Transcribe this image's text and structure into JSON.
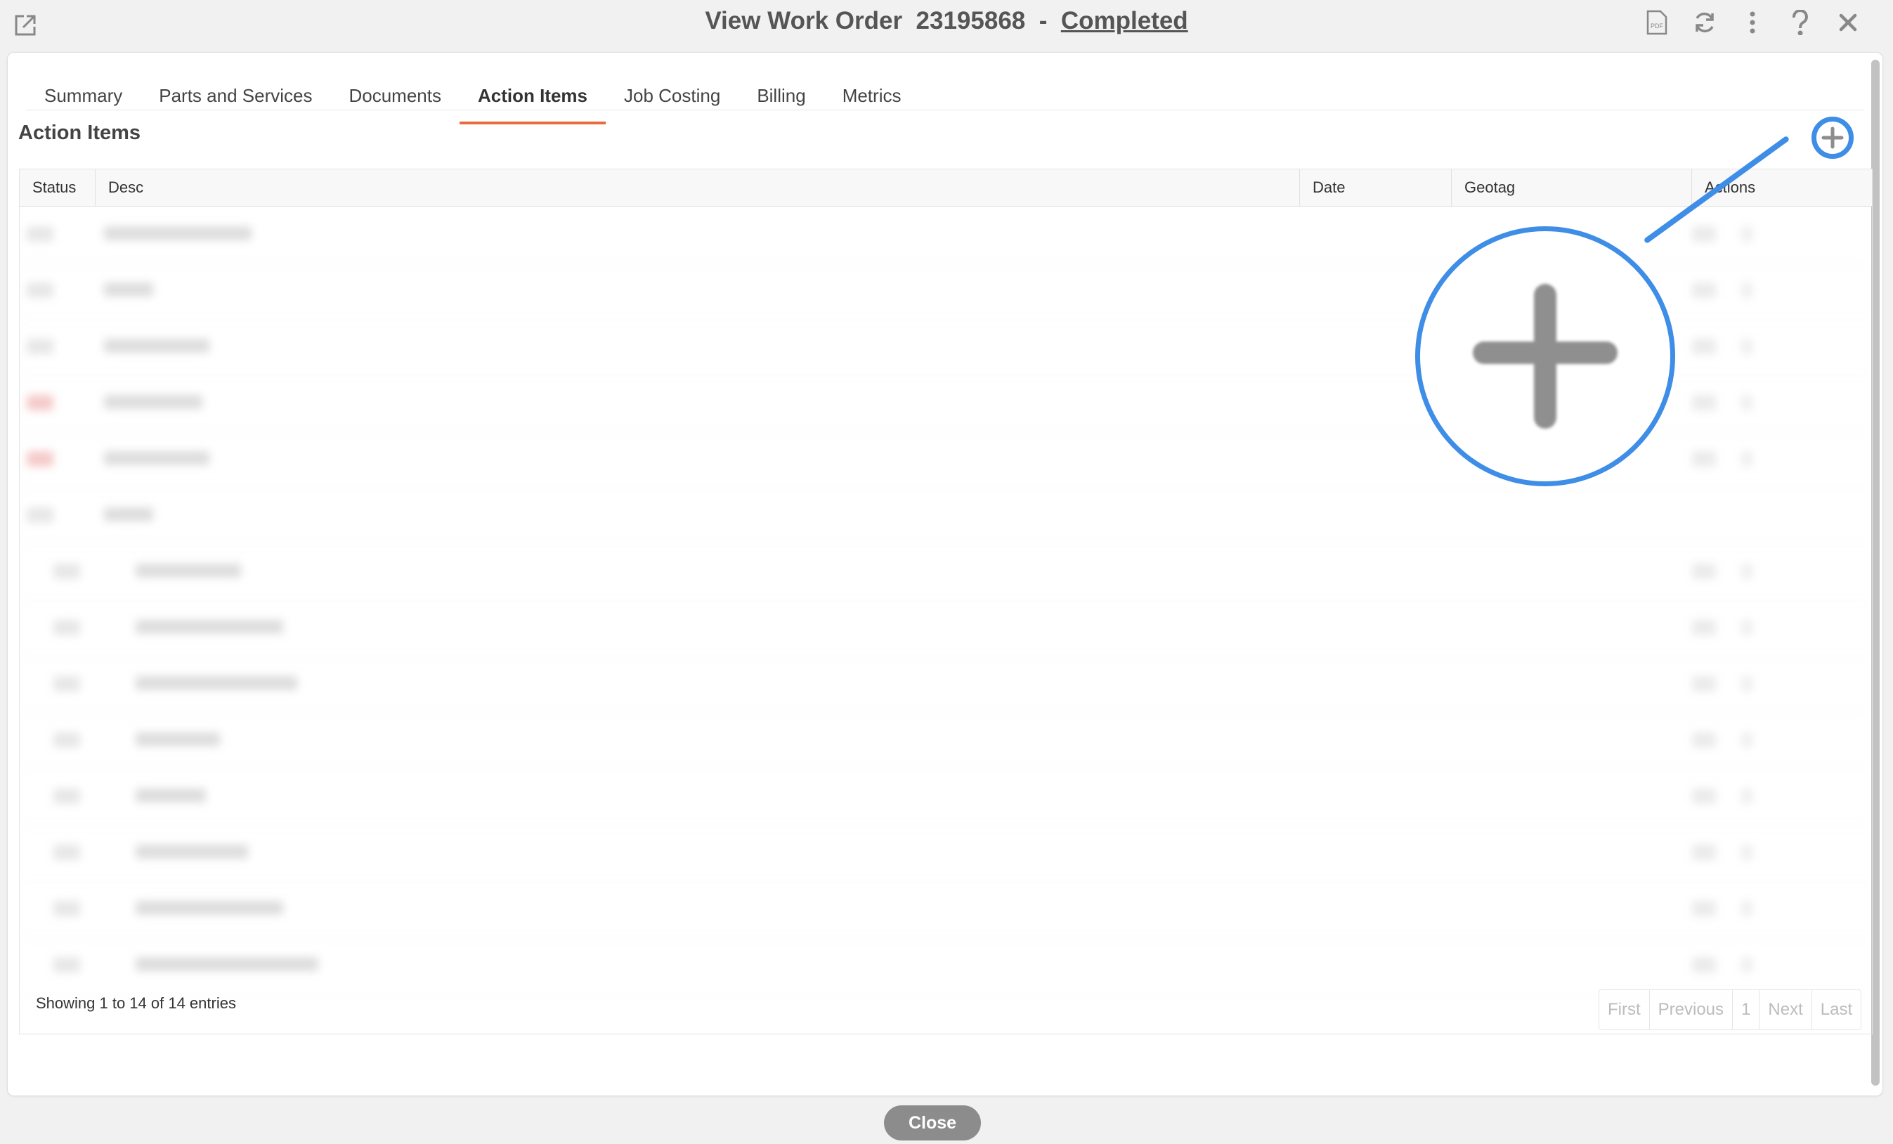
{
  "window": {
    "title_prefix": "View Work Order",
    "work_order_number": "23195868",
    "separator": "-",
    "status": "Completed"
  },
  "top_icons": [
    "popout-icon",
    "pdf-icon",
    "refresh-icon",
    "more-vertical-icon",
    "help-icon",
    "close-icon"
  ],
  "pdf_label": "PDF",
  "tabs": [
    {
      "label": "Summary"
    },
    {
      "label": "Parts and Services"
    },
    {
      "label": "Documents"
    },
    {
      "label": "Action Items",
      "active": true
    },
    {
      "label": "Job Costing"
    },
    {
      "label": "Billing"
    },
    {
      "label": "Metrics"
    }
  ],
  "section": {
    "title": "Action Items"
  },
  "table": {
    "columns": [
      "Status",
      "Desc",
      "Date",
      "Geotag",
      "Actions"
    ],
    "rows_blurred": 14
  },
  "footer": {
    "info": "Showing 1 to 14 of 14 entries",
    "pager": [
      "First",
      "Previous",
      "1",
      "Next",
      "Last"
    ]
  },
  "close_button": "Close",
  "colors": {
    "accent_tab": "#e96b3c",
    "callout": "#3e8de6",
    "close_button": "#8c8c8c"
  }
}
